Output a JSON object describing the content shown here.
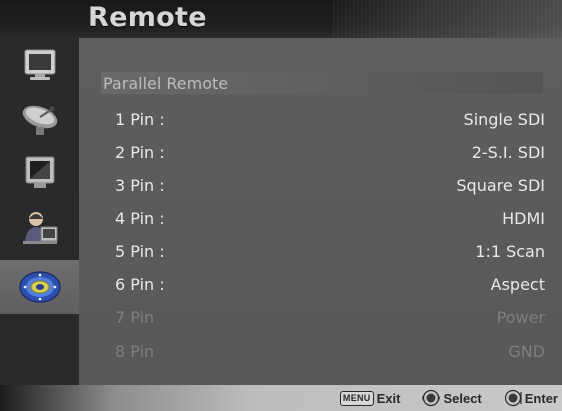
{
  "header": {
    "title": "Remote"
  },
  "sidebar": {
    "items": [
      {
        "icon": "monitor-icon",
        "active": false
      },
      {
        "icon": "satellite-dish-icon",
        "active": false
      },
      {
        "icon": "display-picture-icon",
        "active": false
      },
      {
        "icon": "person-at-desk-icon",
        "active": false
      },
      {
        "icon": "remote-disc-icon",
        "active": true
      }
    ]
  },
  "main": {
    "section": "Parallel Remote",
    "rows": [
      {
        "label": "1 Pin :",
        "value": "Single SDI",
        "enabled": true
      },
      {
        "label": "2 Pin :",
        "value": "2-S.I. SDI",
        "enabled": true
      },
      {
        "label": "3 Pin :",
        "value": "Square SDI",
        "enabled": true
      },
      {
        "label": "4 Pin :",
        "value": "HDMI",
        "enabled": true
      },
      {
        "label": "5 Pin :",
        "value": "1:1 Scan",
        "enabled": true
      },
      {
        "label": "6 Pin :",
        "value": "Aspect",
        "enabled": true
      },
      {
        "label": "7 Pin",
        "value": "Power",
        "enabled": false
      },
      {
        "label": "8 Pin",
        "value": "GND",
        "enabled": false
      }
    ]
  },
  "footer": {
    "menu_key": "MENU",
    "exit_label": "Exit",
    "select_label": "Select",
    "enter_label": "Enter"
  }
}
